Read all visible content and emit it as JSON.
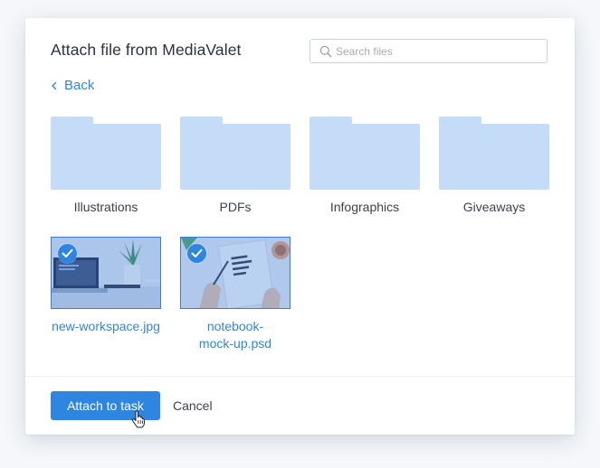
{
  "dialog": {
    "title": "Attach file from MediaValet",
    "search": {
      "placeholder": "Search files",
      "value": ""
    },
    "back_label": "Back"
  },
  "folders": [
    {
      "name": "Illustrations",
      "icon": "folder-icon"
    },
    {
      "name": "PDFs",
      "icon": "folder-icon"
    },
    {
      "name": "Infographics",
      "icon": "folder-icon"
    },
    {
      "name": "Giveaways",
      "icon": "folder-icon"
    }
  ],
  "files": [
    {
      "name": "new-workspace.jpg",
      "selected": true
    },
    {
      "name_line1": "notebook-",
      "name_line2": "mock-up.psd",
      "selected": true
    }
  ],
  "footer": {
    "attach_label": "Attach to task",
    "cancel_label": "Cancel"
  },
  "colors": {
    "accent": "#2f86e0",
    "folder": "#c4dcf8",
    "title_text": "#2b3240"
  }
}
